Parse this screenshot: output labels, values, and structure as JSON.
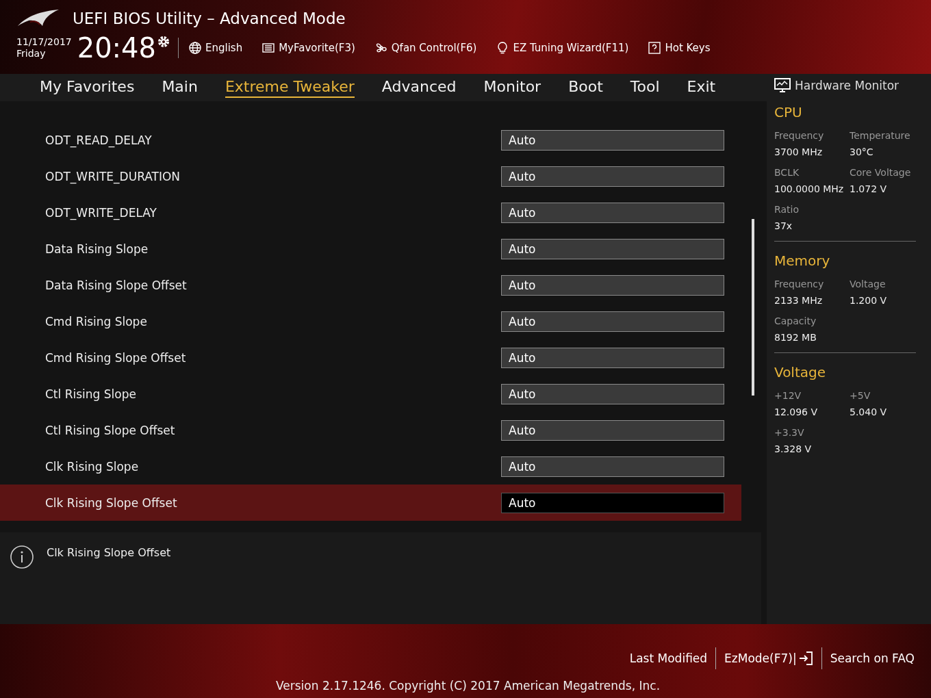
{
  "header": {
    "title": "UEFI BIOS Utility – Advanced Mode",
    "date": "11/17/2017",
    "day": "Friday",
    "time": "20:48",
    "tools": [
      {
        "label": "English"
      },
      {
        "label": "MyFavorite(F3)"
      },
      {
        "label": "Qfan Control(F6)"
      },
      {
        "label": "EZ Tuning Wizard(F11)"
      },
      {
        "label": "Hot Keys"
      }
    ]
  },
  "tabs": [
    {
      "label": "My Favorites",
      "selected": false
    },
    {
      "label": "Main",
      "selected": false
    },
    {
      "label": "Extreme Tweaker",
      "selected": true
    },
    {
      "label": "Advanced",
      "selected": false
    },
    {
      "label": "Monitor",
      "selected": false
    },
    {
      "label": "Boot",
      "selected": false
    },
    {
      "label": "Tool",
      "selected": false
    },
    {
      "label": "Exit",
      "selected": false
    }
  ],
  "settings": [
    {
      "label": "ODT_READ_DELAY",
      "value": "Auto",
      "selected": false
    },
    {
      "label": "ODT_WRITE_DURATION",
      "value": "Auto",
      "selected": false
    },
    {
      "label": "ODT_WRITE_DELAY",
      "value": "Auto",
      "selected": false
    },
    {
      "label": "Data Rising Slope",
      "value": "Auto",
      "selected": false
    },
    {
      "label": "Data Rising Slope Offset",
      "value": "Auto",
      "selected": false
    },
    {
      "label": "Cmd Rising Slope",
      "value": "Auto",
      "selected": false
    },
    {
      "label": "Cmd Rising Slope Offset",
      "value": "Auto",
      "selected": false
    },
    {
      "label": "Ctl Rising Slope",
      "value": "Auto",
      "selected": false
    },
    {
      "label": "Ctl Rising Slope Offset",
      "value": "Auto",
      "selected": false
    },
    {
      "label": "Clk Rising Slope",
      "value": "Auto",
      "selected": false
    },
    {
      "label": "Clk Rising Slope Offset",
      "value": "Auto",
      "selected": true
    }
  ],
  "help": {
    "text": "Clk Rising Slope Offset"
  },
  "monitor": {
    "title": "Hardware Monitor",
    "sections": [
      {
        "heading": "CPU",
        "fields": [
          {
            "label": "Frequency",
            "value": "3700 MHz"
          },
          {
            "label": "Temperature",
            "value": "30°C"
          },
          {
            "label": "BCLK",
            "value": "100.0000 MHz"
          },
          {
            "label": "Core Voltage",
            "value": "1.072 V"
          },
          {
            "label": "Ratio",
            "value": "37x"
          }
        ]
      },
      {
        "heading": "Memory",
        "fields": [
          {
            "label": "Frequency",
            "value": "2133 MHz"
          },
          {
            "label": "Voltage",
            "value": "1.200 V"
          },
          {
            "label": "Capacity",
            "value": "8192 MB"
          }
        ]
      },
      {
        "heading": "Voltage",
        "fields": [
          {
            "label": "+12V",
            "value": "12.096 V"
          },
          {
            "label": "+5V",
            "value": "5.040 V"
          },
          {
            "label": "+3.3V",
            "value": "3.328 V"
          }
        ]
      }
    ]
  },
  "footer": {
    "links": [
      {
        "label": "Last Modified"
      },
      {
        "label": "EzMode(F7)|"
      },
      {
        "label": "Search on FAQ"
      }
    ],
    "version": "Version 2.17.1246. Copyright (C) 2017 American Megatrends, Inc."
  }
}
